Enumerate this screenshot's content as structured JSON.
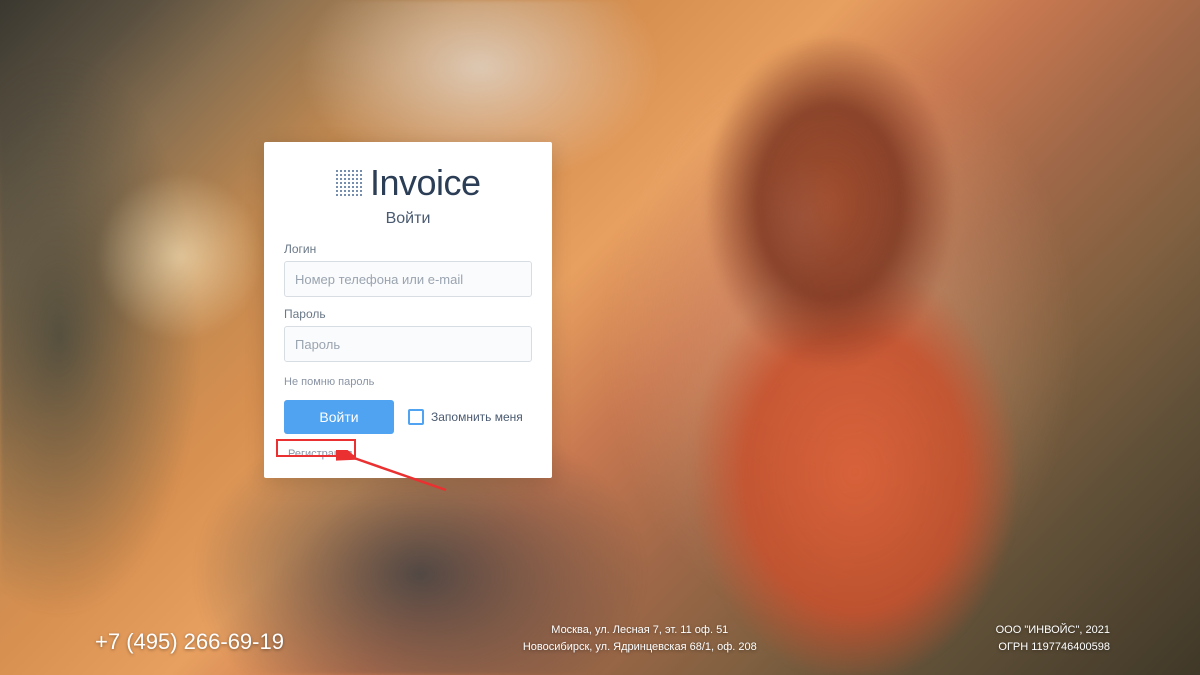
{
  "brand": {
    "name": "Invoice"
  },
  "login": {
    "title": "Войти",
    "login_label": "Логин",
    "login_placeholder": "Номер телефона или e-mail",
    "password_label": "Пароль",
    "password_placeholder": "Пароль",
    "forgot": "Не помню пароль",
    "submit": "Войти",
    "remember": "Запомнить меня",
    "register": "Регистрация"
  },
  "footer": {
    "phone": "+7 (495) 266-69-19",
    "address1": "Москва, ул. Лесная 7, эт. 11 оф. 51",
    "address2": "Новосибирск, ул. Ядринцевская 68/1, оф. 208",
    "company": "ООО \"ИНВОЙС\", 2021",
    "ogrn": "ОГРН 1197746400598"
  }
}
